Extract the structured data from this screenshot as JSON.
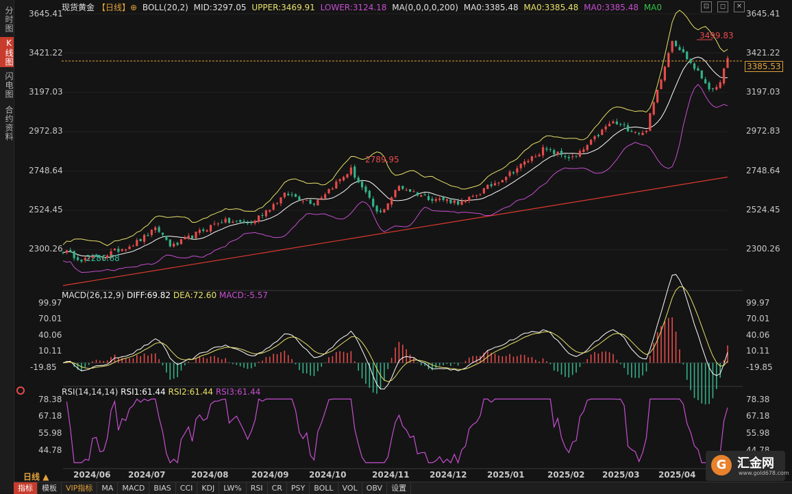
{
  "sidebar": {
    "tabs": [
      "分时图",
      "K线图",
      "闪电图",
      "合约资料"
    ],
    "active_index": 1
  },
  "header": {
    "symbol": "现货黄金",
    "period_tag": "【日线】",
    "boll": "BOLL(20,2)",
    "boll_mid": "MID:3297.05",
    "boll_upper": "UPPER:3469.91",
    "boll_lower": "LOWER:3124.18",
    "ma": "MA(0,0,0,0,200)",
    "ma1": "MA0:3385.48",
    "ma2": "MA0:3385.48",
    "ma3": "MA0:3385.48",
    "ma4": "MA0"
  },
  "window_controls": [
    "⊡",
    "◻",
    "✕"
  ],
  "price_axis": {
    "ticks": [
      "3645.41",
      "3421.22",
      "3197.03",
      "2972.83",
      "2748.64",
      "2524.45",
      "2300.26"
    ],
    "current": "3385.53"
  },
  "annotations": {
    "high": "3499.83",
    "mid_high": "2789.95",
    "low": "2286.68"
  },
  "macd_panel": {
    "title": "MACD(26,12,9)",
    "diff": "DIFF:69.82",
    "dea": "DEA:72.60",
    "macd": "MACD:-5.57",
    "ticks": [
      "99.97",
      "70.01",
      "40.06",
      "10.11",
      "-19.85"
    ]
  },
  "rsi_panel": {
    "title": "RSI(14,14,14)",
    "rsi1": "RSI1:61.44",
    "rsi2": "RSI2:61.44",
    "rsi3": "RSI3:61.44",
    "ticks": [
      "78.38",
      "67.18",
      "55.98",
      "44.78"
    ]
  },
  "x_axis": {
    "labels": [
      "2024/06",
      "2024/07",
      "2024/08",
      "2024/09",
      "2024/10",
      "2024/11",
      "2024/12",
      "2025/01",
      "2025/02",
      "2025/03",
      "2025/04"
    ]
  },
  "period_label": "日线",
  "toolbar": {
    "items": [
      "指标",
      "模板",
      "VIP指标",
      "MA",
      "MACD",
      "BIAS",
      "CCI",
      "KDJ",
      "LW%",
      "RSI",
      "CR",
      "PSY",
      "BOLL",
      "VOL",
      "OBV",
      "设置"
    ]
  },
  "logo": {
    "title": "汇金网",
    "url": "www.gold678.com",
    "glyph": "G"
  },
  "colors": {
    "up": "#e84b4b",
    "down": "#33b28a",
    "mid": "#ffffff",
    "upper": "#e8e26a",
    "lower": "#c64fd1",
    "ma200": "#e03a2e",
    "current": "#e3a33a",
    "rsi": "#c64fd1"
  },
  "chart_data": [
    {
      "type": "candlestick",
      "title": "现货黄金 日线",
      "ylim": [
        2148,
        3645.41
      ],
      "price_path": [
        {
          "date": "2024/05/27",
          "price": 2350
        },
        {
          "date": "2024/06/07",
          "price": 2300
        },
        {
          "date": "2024/06/20",
          "price": 2330
        },
        {
          "date": "2024/07/05",
          "price": 2390
        },
        {
          "date": "2024/07/17",
          "price": 2470
        },
        {
          "date": "2024/07/25",
          "price": 2370
        },
        {
          "date": "2024/08/20",
          "price": 2510
        },
        {
          "date": "2024/09/06",
          "price": 2500
        },
        {
          "date": "2024/09/25",
          "price": 2660
        },
        {
          "date": "2024/10/10",
          "price": 2610
        },
        {
          "date": "2024/10/30",
          "price": 2789.95
        },
        {
          "date": "2024/11/14",
          "price": 2540
        },
        {
          "date": "2024/11/25",
          "price": 2700
        },
        {
          "date": "2024/12/10",
          "price": 2640
        },
        {
          "date": "2024/12/30",
          "price": 2610
        },
        {
          "date": "2025/01/24",
          "price": 2770
        },
        {
          "date": "2025/02/11",
          "price": 2900
        },
        {
          "date": "2025/02/28",
          "price": 2850
        },
        {
          "date": "2025/03/20",
          "price": 3050
        },
        {
          "date": "2025/04/07",
          "price": 2980
        },
        {
          "date": "2025/04/22",
          "price": 3499.83
        },
        {
          "date": "2025/05/15",
          "price": 3200
        },
        {
          "date": "2025/05/22",
          "price": 3385.53
        }
      ],
      "ma200": {
        "start": 2160,
        "end": 2750
      }
    },
    {
      "type": "bar",
      "title": "MACD(26,12,9)",
      "ylim": [
        -40,
        118
      ]
    },
    {
      "type": "line",
      "title": "RSI(14,14,14)",
      "ylim": [
        35,
        82
      ]
    }
  ]
}
